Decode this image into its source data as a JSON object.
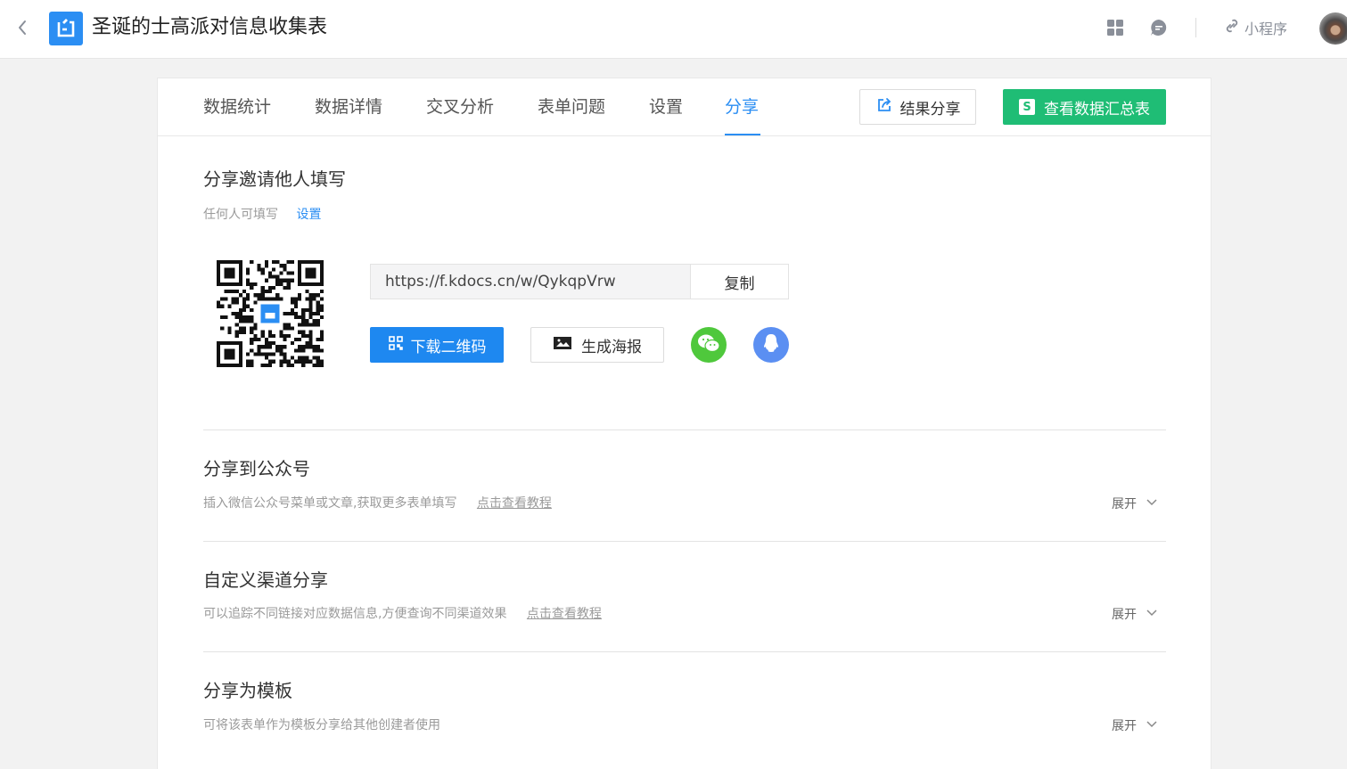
{
  "header": {
    "title": "圣诞的士高派对信息收集表",
    "mini_program_label": "小程序",
    "icons": [
      "back-arrow-icon",
      "app-logo-icon",
      "apps-grid-icon",
      "message-icon",
      "link-icon",
      "avatar"
    ]
  },
  "tabs": [
    {
      "label": "数据统计"
    },
    {
      "label": "数据详情"
    },
    {
      "label": "交叉分析"
    },
    {
      "label": "表单问题"
    },
    {
      "label": "设置"
    },
    {
      "label": "分享",
      "active": true
    }
  ],
  "actions": {
    "share_result_label": "结果分享",
    "summary_label": "查看数据汇总表",
    "summary_badge": "S"
  },
  "invite": {
    "title": "分享邀请他人填写",
    "permission_text": "任何人可填写",
    "settings_link": "设置",
    "url": "https://f.kdocs.cn/w/QykqpVrw",
    "copy_label": "复制",
    "download_qr_label": "下载二维码",
    "poster_label": "生成海报"
  },
  "sections": [
    {
      "title": "分享到公众号",
      "desc": "插入微信公众号菜单或文章,获取更多表单填写",
      "link": "点击查看教程",
      "expand": "展开"
    },
    {
      "title": "自定义渠道分享",
      "desc": "可以追踪不同链接对应数据信息,方便查询不同渠道效果",
      "link": "点击查看教程",
      "expand": "展开"
    },
    {
      "title": "分享为模板",
      "desc": "可将该表单作为模板分享给其他创建者使用",
      "expand": "展开"
    }
  ],
  "colors": {
    "accent": "#2b8ef3",
    "green": "#1fbd75",
    "wechat": "#4fc83c",
    "qq": "#5b8ff2"
  }
}
